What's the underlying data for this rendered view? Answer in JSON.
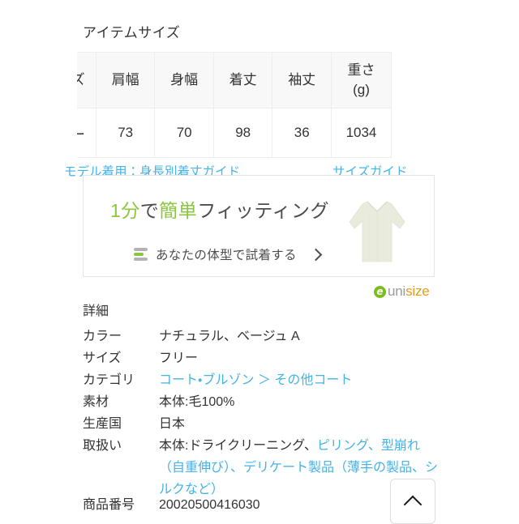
{
  "size_section": {
    "heading": "アイテムサイズ",
    "table": {
      "columns": [
        "サイズ",
        "肩幅",
        "身幅",
        "着丈",
        "袖丈",
        "重さ\n(g)"
      ],
      "column_labels": {
        "c0": "サイズ",
        "c1": "肩幅",
        "c2": "身幅",
        "c3": "着丈",
        "c4": "袖丈",
        "c5_line1": "重さ",
        "c5_line2": "(g)"
      },
      "rows": [
        {
          "size": "フリー",
          "shoulder": "73",
          "body_width": "70",
          "length": "98",
          "sleeve": "36",
          "weight": "1034"
        }
      ]
    },
    "links": {
      "model_guide": "モデル着用：身長別着丈ガイド",
      "size_guide": "サイズガイド"
    }
  },
  "fitting_banner": {
    "title_part1": "1分",
    "title_part2": "で",
    "title_part3": "簡単",
    "title_part4": "フィッティング",
    "cta_label": "あなたの体型で試着する",
    "icon": "sliders-icon",
    "arrow": "chevron-right-icon",
    "product_illustration": "long-coat-illustration"
  },
  "unisize_logo": {
    "mark": "e",
    "text_part1": "uni",
    "text_part2": "size"
  },
  "details": {
    "heading": "詳細",
    "rows": [
      {
        "label": "カラー",
        "value": "ナチュラル、ベージュ A"
      },
      {
        "label": "サイズ",
        "value": "フリー"
      },
      {
        "label": "カテゴリ",
        "value": "コート・ブルゾン ＞ その他コート",
        "is_link": true
      },
      {
        "label": "素材",
        "value": "本体:毛100%"
      },
      {
        "label": "生産国",
        "value": "日本"
      },
      {
        "label": "取扱い",
        "value_plain": "本体:ドライクリーニング、",
        "value_link": "ピリング、型崩れ（自重伸び）、デリケート製品（薄手の製品、シルクなど）"
      },
      {
        "label": "商品番号",
        "value": "20020500416030"
      }
    ]
  },
  "scroll_top_button": {
    "icon": "chevron-up-icon",
    "label": ""
  },
  "colors": {
    "link_blue": "#45b3e7",
    "accent_green": "#8cc540",
    "unisize_orange": "#e79a1a",
    "unisize_gray": "#9a9a9a",
    "text": "#333333",
    "table_header_bg": "#f8f8f8",
    "border": "#eeeeee"
  }
}
